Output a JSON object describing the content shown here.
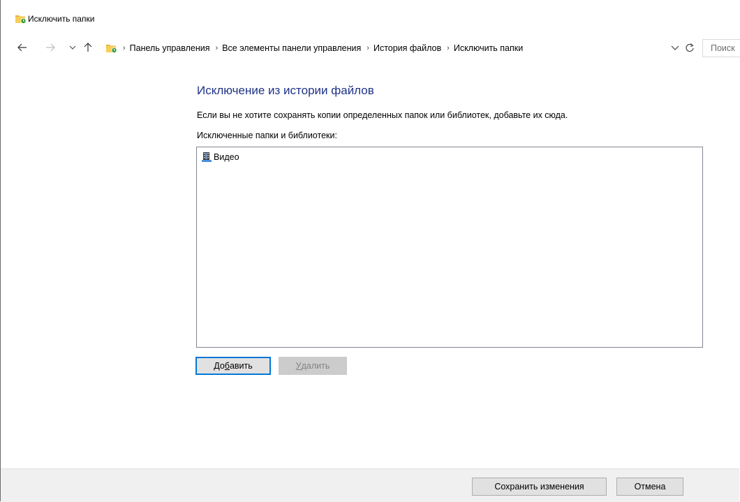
{
  "window": {
    "title": "Исключить папки",
    "icon": "file-history-folder-icon"
  },
  "nav": {
    "back_icon": "arrow-left-icon",
    "forward_icon": "arrow-right-icon",
    "recent_icon": "chevron-down-icon",
    "up_icon": "arrow-up-icon",
    "breadcrumbs": [
      "Панель управления",
      "Все элементы панели управления",
      "История файлов",
      "Исключить папки"
    ],
    "search_placeholder": "Поиск"
  },
  "main": {
    "heading": "Исключение из истории файлов",
    "description": "Если вы не хотите сохранять копии определенных папок или библиотек, добавьте их сюда.",
    "list_label": "Исключенные папки и библиотеки:",
    "excluded_items": [
      {
        "label": "Видео",
        "icon": "video-library-icon"
      }
    ],
    "add_button": {
      "pre": "До",
      "accel": "б",
      "post": "авить"
    },
    "remove_button": {
      "pre": "",
      "accel": "У",
      "post": "далить"
    }
  },
  "footer": {
    "save_label": "Сохранить изменения",
    "cancel_label": "Отмена"
  },
  "colors": {
    "heading": "#1e3287",
    "focus_border": "#0078d7",
    "footer_bg": "#f0f0f0",
    "disabled_text": "#838383"
  }
}
